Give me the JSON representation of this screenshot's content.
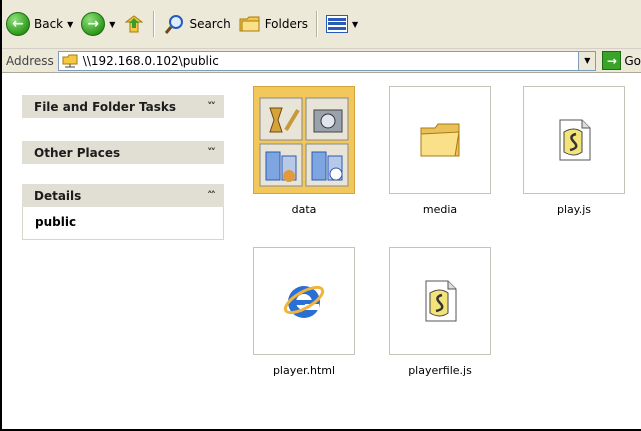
{
  "toolbar": {
    "back_label": "Back",
    "search_label": "Search",
    "folders_label": "Folders"
  },
  "address": {
    "label": "Address",
    "value": "\\\\192.168.0.102\\public",
    "go_label": "Go"
  },
  "taskpane": {
    "file_folder_tasks": "File and Folder Tasks",
    "other_places": "Other Places",
    "details": "Details",
    "details_name": "public"
  },
  "files": [
    {
      "name": "data",
      "icon": "folder-thumbnail-icon"
    },
    {
      "name": "media",
      "icon": "folder-icon"
    },
    {
      "name": "play.js",
      "icon": "script-file-icon"
    },
    {
      "name": "player.html",
      "icon": "internet-explorer-icon"
    },
    {
      "name": "playerfile.js",
      "icon": "script-file-icon"
    }
  ],
  "colors": {
    "toolbar_bg": "#ece9d8",
    "panel_header": "#e1dfd3",
    "folder_yellow": "#f2c75c",
    "ie_blue": "#2a6fd6"
  }
}
